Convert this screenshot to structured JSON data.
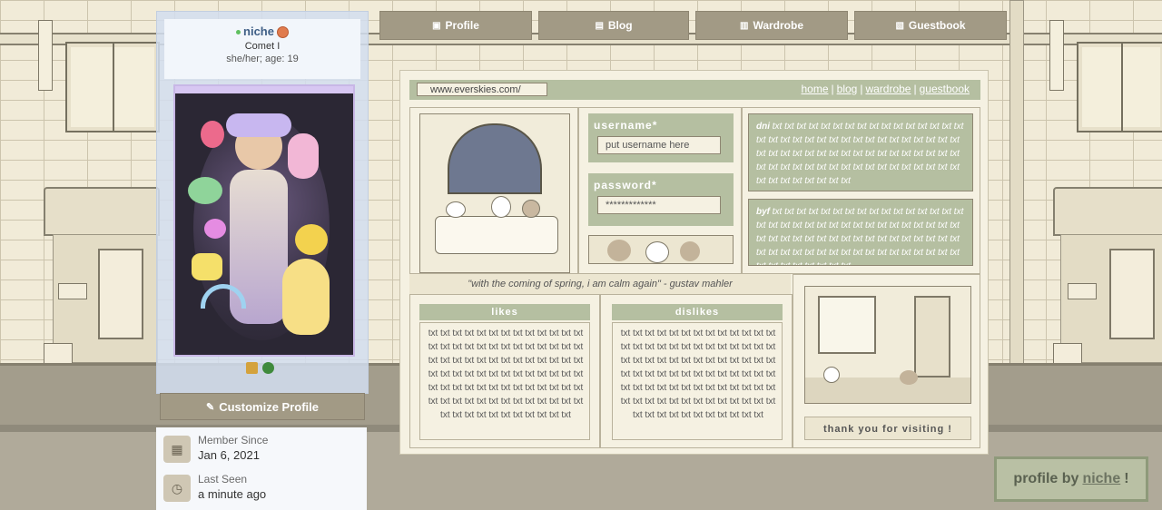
{
  "profile": {
    "username": "niche",
    "title": "Comet I",
    "pronouns": "she/her; age: 19",
    "customize_label": "Customize Profile",
    "member_since_label": "Member Since",
    "member_since_value": "Jan 6, 2021",
    "last_seen_label": "Last Seen",
    "last_seen_value": "a minute ago"
  },
  "tabs": [
    {
      "label": "Profile",
      "icon": "profile-icon"
    },
    {
      "label": "Blog",
      "icon": "blog-icon"
    },
    {
      "label": "Wardrobe",
      "icon": "wardrobe-icon"
    },
    {
      "label": "Guestbook",
      "icon": "guestbook-icon"
    }
  ],
  "card": {
    "url": "www.everskies.com/",
    "links": [
      "home",
      "blog",
      "wardrobe",
      "guestbook"
    ],
    "username_label": "username*",
    "username_placeholder": "put username here",
    "password_label": "password*",
    "password_value": "*************",
    "dni_label": "dni",
    "byf_label": "byf",
    "filler": "txt txt txt txt txt txt txt txt txt txt txt txt txt txt txt txt txt txt txt txt txt txt txt txt txt txt txt txt txt txt txt txt txt txt txt txt txt txt txt txt txt txt txt txt txt txt txt txt txt txt txt txt txt txt txt txt txt txt txt txt txt txt txt txt txt txt txt txt txt txt txt txt txt txt txt",
    "quote": "\"with the coming of spring, i am calm again\" - gustav mahler",
    "likes_label": "likes",
    "dislikes_label": "dislikes",
    "list_filler": "txt txt txt txt txt txt txt txt txt txt txt txt txt txt txt txt txt txt txt txt txt txt txt txt txt txt txt txt txt txt txt txt txt txt txt txt txt txt txt txt txt txt txt txt txt txt txt txt txt txt txt txt txt txt txt txt txt txt txt txt txt txt txt txt txt txt txt txt txt txt txt txt txt txt txt txt txt txt txt txt txt txt txt txt txt txt txt txt txt",
    "thanks": "thank you for visiting !"
  },
  "credit": {
    "prefix": "profile by",
    "name": "niche",
    "suffix": "!"
  },
  "colors": {
    "sage": "#b5bfa1",
    "taupe": "#a29a85",
    "cream": "#f5f1e2"
  }
}
